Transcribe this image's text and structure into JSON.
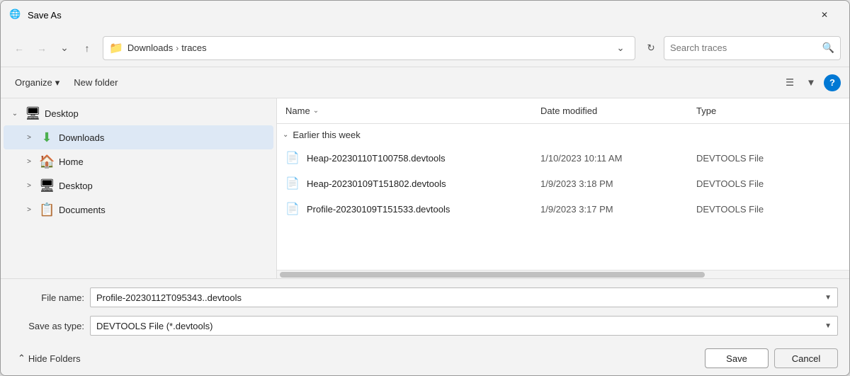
{
  "dialog": {
    "title": "Save As"
  },
  "titlebar": {
    "close_label": "✕",
    "icon": "🌐"
  },
  "navbar": {
    "back_tooltip": "Back",
    "forward_tooltip": "Forward",
    "dropdown_tooltip": "Recent locations",
    "up_tooltip": "Up to Desktop",
    "address": {
      "folder_icon": "📁",
      "path1": "Downloads",
      "separator1": "›",
      "path2": "traces"
    },
    "dropdown_arrow": "⌄",
    "refresh_icon": "↻",
    "search_placeholder": "Search traces",
    "search_icon": "🔍"
  },
  "toolbar": {
    "organize_label": "Organize",
    "organize_arrow": "▾",
    "new_folder_label": "New folder",
    "view_icon": "☰",
    "view_arrow": "▾",
    "help_label": "?"
  },
  "file_columns": {
    "name": "Name",
    "sort_indicator": "⌄",
    "date_modified": "Date modified",
    "type": "Type"
  },
  "sidebar": {
    "items": [
      {
        "id": "desktop-top",
        "expand": "⌄",
        "icon": "🖥",
        "label": "Desktop",
        "expanded": true,
        "indent": 0
      },
      {
        "id": "downloads",
        "expand": ">",
        "icon": "⬇",
        "label": "Downloads",
        "expanded": false,
        "indent": 1,
        "selected": true
      },
      {
        "id": "home",
        "expand": ">",
        "icon": "🏠",
        "label": "Home",
        "expanded": false,
        "indent": 1
      },
      {
        "id": "desktop-sub",
        "expand": ">",
        "icon": "🖥",
        "label": "Desktop",
        "expanded": false,
        "indent": 1
      },
      {
        "id": "documents",
        "expand": ">",
        "icon": "📋",
        "label": "Documents",
        "expanded": false,
        "indent": 1
      }
    ]
  },
  "file_groups": [
    {
      "id": "earlier-this-week",
      "label": "Earlier this week",
      "toggle": "⌄",
      "files": [
        {
          "name": "Heap-20230110T100758.devtools",
          "date_modified": "1/10/2023 10:11 AM",
          "type": "DEVTOOLS File"
        },
        {
          "name": "Heap-20230109T151802.devtools",
          "date_modified": "1/9/2023 3:18 PM",
          "type": "DEVTOOLS File"
        },
        {
          "name": "Profile-20230109T151533.devtools",
          "date_modified": "1/9/2023 3:17 PM",
          "type": "DEVTOOLS File"
        }
      ]
    }
  ],
  "bottom": {
    "file_name_label": "File name:",
    "file_name_value": "Profile-20230112T095343..devtools",
    "save_type_label": "Save as type:",
    "save_type_value": "DEVTOOLS File (*.devtools)",
    "hide_folders_icon": "⌃",
    "hide_folders_label": "Hide Folders",
    "save_label": "Save",
    "cancel_label": "Cancel"
  }
}
